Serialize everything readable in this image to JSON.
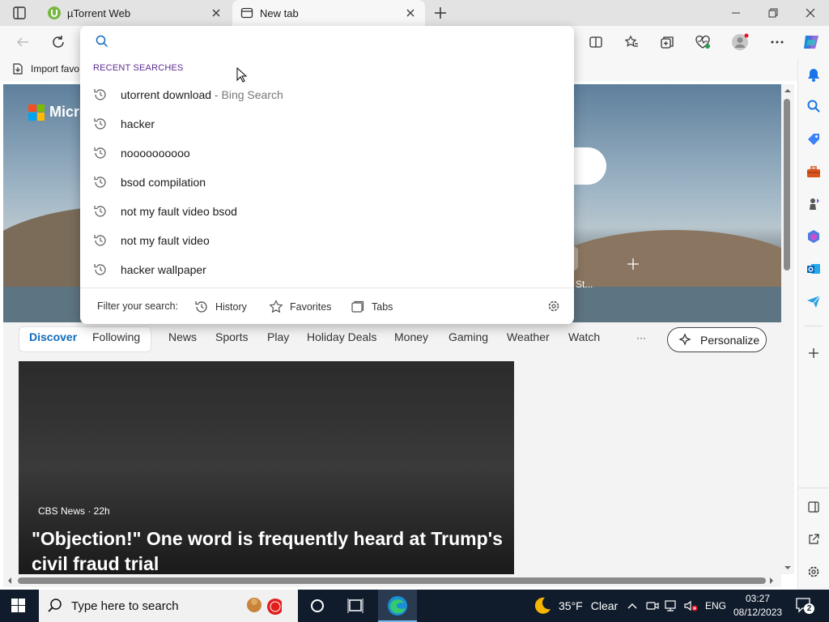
{
  "tabs": [
    {
      "title": "µTorrent Web"
    },
    {
      "title": "New tab"
    }
  ],
  "favorites_bar": {
    "import_label": "Import favo"
  },
  "search": {
    "placeholder": ""
  },
  "dropdown": {
    "heading": "RECENT SEARCHES",
    "items": [
      {
        "query": "utorrent download",
        "suffix": " - Bing Search"
      },
      {
        "query": "hacker",
        "suffix": ""
      },
      {
        "query": "noooooooooo",
        "suffix": ""
      },
      {
        "query": "bsod compilation",
        "suffix": ""
      },
      {
        "query": "not my fault video bsod",
        "suffix": ""
      },
      {
        "query": "not my fault video",
        "suffix": ""
      },
      {
        "query": "hacker wallpaper",
        "suffix": ""
      }
    ],
    "filter_label": "Filter your search:",
    "filters": [
      "History",
      "Favorites",
      "Tabs"
    ]
  },
  "newtab": {
    "logo_text": "Micro",
    "tile_stub_label": "St...",
    "feed_tabs": [
      "Discover",
      "Following",
      "News",
      "Sports",
      "Play",
      "Holiday Deals",
      "Money",
      "Gaming",
      "Weather",
      "Watch"
    ],
    "more_label": "···",
    "personalize_label": "Personalize",
    "card": {
      "source": "CBS News · 22h",
      "headline": "\"Objection!\" One word is frequently heard at Trump's civil fraud trial"
    }
  },
  "taskbar": {
    "search_placeholder": "Type here to search",
    "weather_temp": "35°F",
    "weather_cond": "Clear",
    "language": "ENG",
    "time": "03:27",
    "date": "08/12/2023",
    "notification_count": "2"
  },
  "colors": {
    "accent_blue": "#0f6cbd",
    "heading_purple": "#5c2d91",
    "taskbar_bg": "#101c2c",
    "tab_strip_bg": "#e3e3e3"
  }
}
